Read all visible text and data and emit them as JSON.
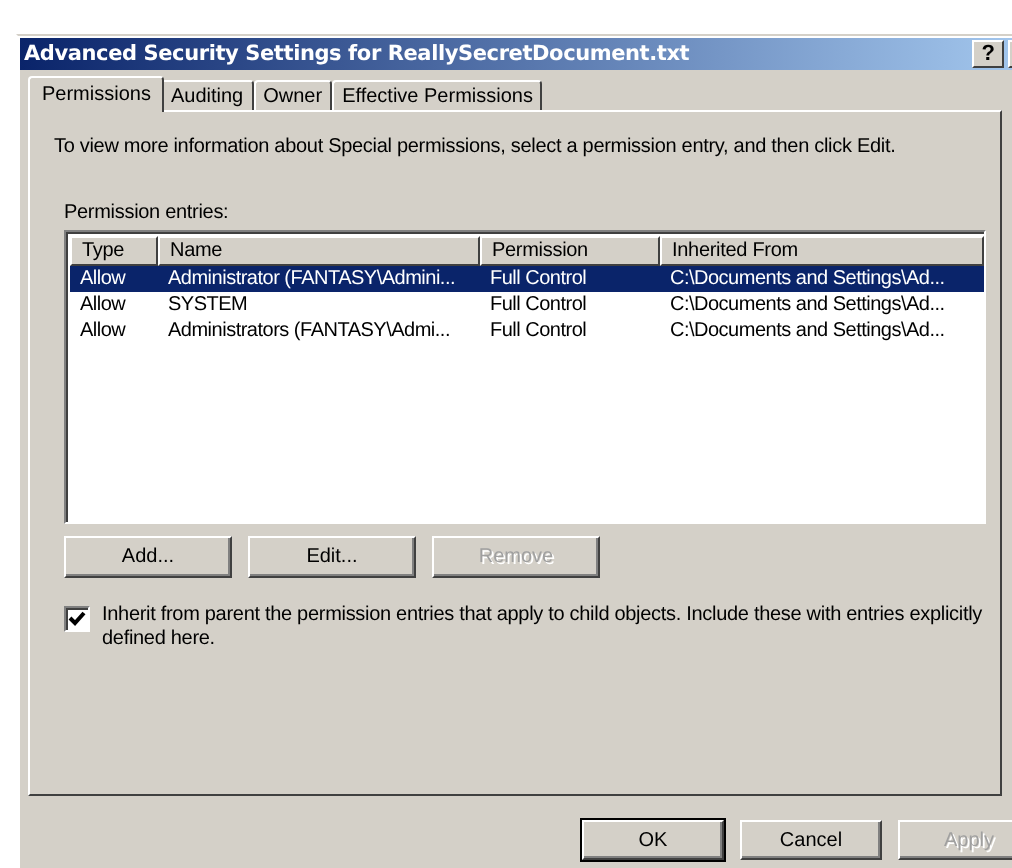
{
  "window": {
    "title": "Advanced Security Settings for ReallySecretDocument.txt",
    "help_button": "?"
  },
  "tabs": [
    {
      "label": "Permissions",
      "selected": true
    },
    {
      "label": "Auditing",
      "selected": false
    },
    {
      "label": "Owner",
      "selected": false
    },
    {
      "label": "Effective Permissions",
      "selected": false
    }
  ],
  "instructions": "To view more information about Special permissions, select a permission entry, and then click Edit.",
  "entries_label": "Permission entries:",
  "table": {
    "columns": [
      "Type",
      "Name",
      "Permission",
      "Inherited From"
    ],
    "rows": [
      {
        "cells": [
          "Allow",
          "Administrator (FANTASY\\Admini...",
          "Full Control",
          "C:\\Documents and Settings\\Ad..."
        ],
        "selected": true
      },
      {
        "cells": [
          "Allow",
          "SYSTEM",
          "Full Control",
          "C:\\Documents and Settings\\Ad..."
        ],
        "selected": false
      },
      {
        "cells": [
          "Allow",
          "Administrators (FANTASY\\Admi...",
          "Full Control",
          "C:\\Documents and Settings\\Ad..."
        ],
        "selected": false
      }
    ]
  },
  "entry_buttons": [
    {
      "label": "Add...",
      "disabled": false
    },
    {
      "label": "Edit...",
      "disabled": false
    },
    {
      "label": "Remove",
      "disabled": true
    }
  ],
  "inherit_checkbox": {
    "label": "Inherit from parent the permission entries that apply to child objects. Include these with entries explicitly defined here.",
    "checked": true
  },
  "dialog_buttons": [
    {
      "label": "OK",
      "disabled": false,
      "default": true
    },
    {
      "label": "Cancel",
      "disabled": false,
      "default": false
    },
    {
      "label": "Apply",
      "disabled": true,
      "default": false
    }
  ]
}
